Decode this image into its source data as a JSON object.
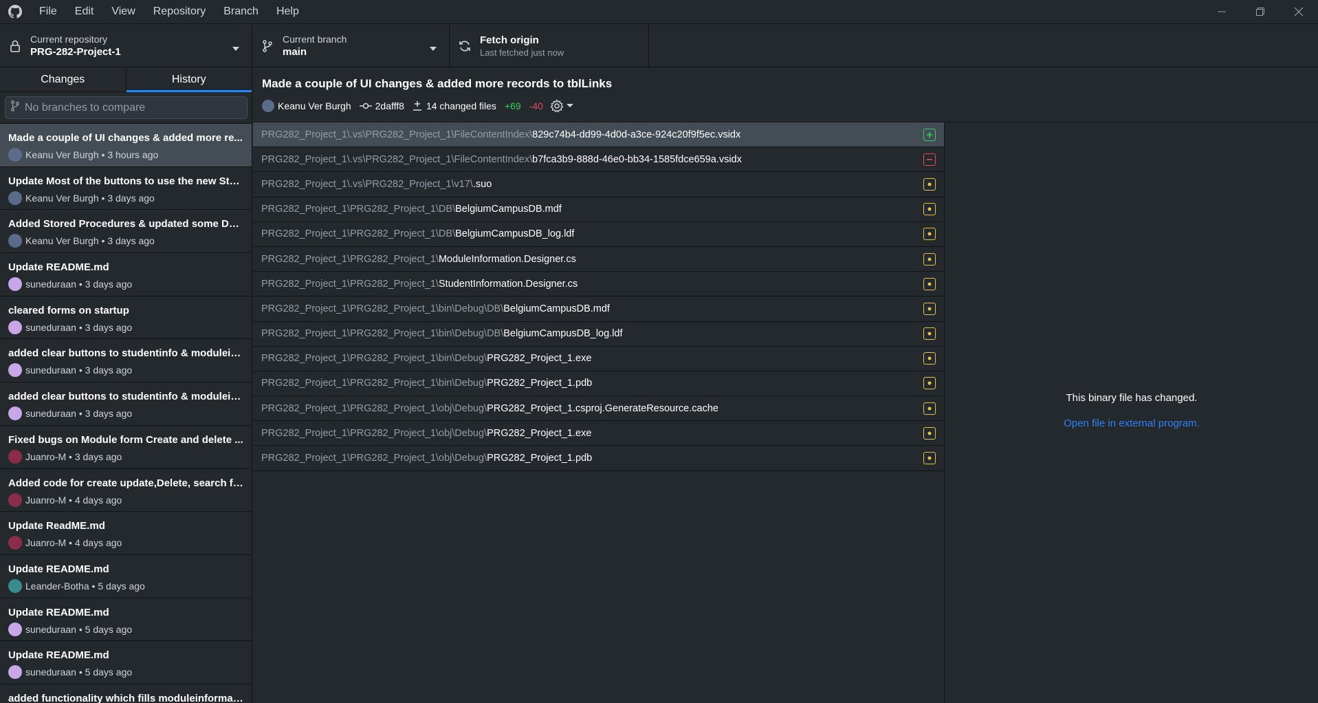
{
  "menu": [
    "File",
    "Edit",
    "View",
    "Repository",
    "Branch",
    "Help"
  ],
  "toolbar": {
    "repo_label": "Current repository",
    "repo_value": "PRG-282-Project-1",
    "branch_label": "Current branch",
    "branch_value": "main",
    "fetch_label": "Fetch origin",
    "fetch_sub": "Last fetched just now"
  },
  "tabs": {
    "changes": "Changes",
    "history": "History"
  },
  "branch_compare_placeholder": "No branches to compare",
  "commits": [
    {
      "title": "Made a couple of UI changes & added more re...",
      "author": "Keanu Ver Burgh",
      "time": "3 hours ago",
      "avatar": "#5a6b8c"
    },
    {
      "title": "Update Most of the buttons to use the new Sto...",
      "author": "Keanu Ver Burgh",
      "time": "3 days ago",
      "avatar": "#5a6b8c"
    },
    {
      "title": "Added Stored Procedures & updated some DB...",
      "author": "Keanu Ver Burgh",
      "time": "3 days ago",
      "avatar": "#5a6b8c"
    },
    {
      "title": "Update README.md",
      "author": "suneduraan",
      "time": "3 days ago",
      "avatar": "#c9a6e8"
    },
    {
      "title": "cleared forms on startup",
      "author": "suneduraan",
      "time": "3 days ago",
      "avatar": "#c9a6e8"
    },
    {
      "title": "added clear buttons to studentinfo & moduleinf...",
      "author": "suneduraan",
      "time": "3 days ago",
      "avatar": "#c9a6e8"
    },
    {
      "title": "added clear buttons to studentinfo & moduleinf...",
      "author": "suneduraan",
      "time": "3 days ago",
      "avatar": "#c9a6e8"
    },
    {
      "title": "Fixed bugs on Module form Create and delete ...",
      "author": "Juanro-M",
      "time": "3 days ago",
      "avatar": "#8b2d4a"
    },
    {
      "title": "Added code for create update,Delete, search fu...",
      "author": "Juanro-M",
      "time": "4 days ago",
      "avatar": "#8b2d4a"
    },
    {
      "title": "Update ReadME.md",
      "author": "Juanro-M",
      "time": "4 days ago",
      "avatar": "#8b2d4a"
    },
    {
      "title": "Update README.md",
      "author": "Leander-Botha",
      "time": "5 days ago",
      "avatar": "#3a8c8c"
    },
    {
      "title": "Update README.md",
      "author": "suneduraan",
      "time": "5 days ago",
      "avatar": "#c9a6e8"
    },
    {
      "title": "Update README.md",
      "author": "suneduraan",
      "time": "5 days ago",
      "avatar": "#c9a6e8"
    },
    {
      "title": "added functionality which fills moduleinformati...",
      "author": "",
      "time": "",
      "avatar": "#c9a6e8"
    }
  ],
  "commit_detail": {
    "title": "Made a couple of UI changes & added more records to tblLinks",
    "author": "Keanu Ver Burgh",
    "sha": "2dafff8",
    "changed_files": "14 changed files",
    "additions": "+69",
    "deletions": "-40"
  },
  "files": [
    {
      "dir": "PRG282_Project_1\\.vs\\PRG282_Project_1\\FileContentIndex\\",
      "name": "829c74b4-dd99-4d0d-a3ce-924c20f9f5ec.vsidx",
      "status": "added"
    },
    {
      "dir": "PRG282_Project_1\\.vs\\PRG282_Project_1\\FileContentIndex\\",
      "name": "b7fca3b9-888d-46e0-bb34-1585fdce659a.vsidx",
      "status": "deleted"
    },
    {
      "dir": "PRG282_Project_1\\.vs\\PRG282_Project_1\\v17\\",
      "name": ".suo",
      "status": "modified"
    },
    {
      "dir": "PRG282_Project_1\\PRG282_Project_1\\DB\\",
      "name": "BelgiumCampusDB.mdf",
      "status": "modified"
    },
    {
      "dir": "PRG282_Project_1\\PRG282_Project_1\\DB\\",
      "name": "BelgiumCampusDB_log.ldf",
      "status": "modified"
    },
    {
      "dir": "PRG282_Project_1\\PRG282_Project_1\\",
      "name": "ModuleInformation.Designer.cs",
      "status": "modified"
    },
    {
      "dir": "PRG282_Project_1\\PRG282_Project_1\\",
      "name": "StudentInformation.Designer.cs",
      "status": "modified"
    },
    {
      "dir": "PRG282_Project_1\\PRG282_Project_1\\bin\\Debug\\DB\\",
      "name": "BelgiumCampusDB.mdf",
      "status": "modified"
    },
    {
      "dir": "PRG282_Project_1\\PRG282_Project_1\\bin\\Debug\\DB\\",
      "name": "BelgiumCampusDB_log.ldf",
      "status": "modified"
    },
    {
      "dir": "PRG282_Project_1\\PRG282_Project_1\\bin\\Debug\\",
      "name": "PRG282_Project_1.exe",
      "status": "modified"
    },
    {
      "dir": "PRG282_Project_1\\PRG282_Project_1\\bin\\Debug\\",
      "name": "PRG282_Project_1.pdb",
      "status": "modified"
    },
    {
      "dir": "PRG282_Project_1\\PRG282_Project_1\\obj\\Debug\\",
      "name": "PRG282_Project_1.csproj.GenerateResource.cache",
      "status": "modified"
    },
    {
      "dir": "PRG282_Project_1\\PRG282_Project_1\\obj\\Debug\\",
      "name": "PRG282_Project_1.exe",
      "status": "modified"
    },
    {
      "dir": "PRG282_Project_1\\PRG282_Project_1\\obj\\Debug\\",
      "name": "PRG282_Project_1.pdb",
      "status": "modified"
    }
  ],
  "diff": {
    "message": "This binary file has changed.",
    "link": "Open file in external program."
  }
}
